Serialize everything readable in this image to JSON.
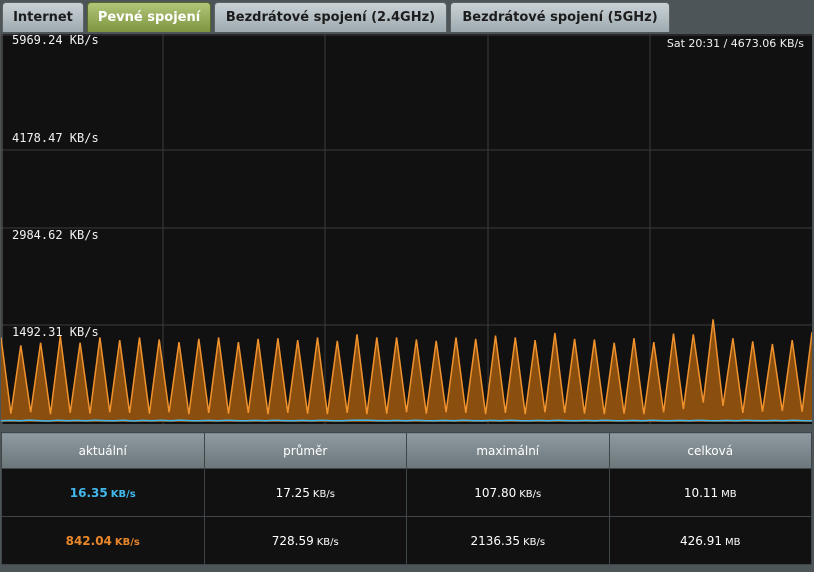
{
  "tabs": [
    {
      "label": "Internet",
      "active": false
    },
    {
      "label": "Pevné spojení",
      "active": true
    },
    {
      "label": "Bezdrátové spojení (2.4GHz)",
      "active": false
    },
    {
      "label": "Bezdrátové spojení (5GHz)",
      "active": false
    }
  ],
  "graph": {
    "y_ticks": [
      "5969.24 KB/s",
      "4178.47 KB/s",
      "2984.62 KB/s",
      "1492.31 KB/s"
    ],
    "cursor_readout": "Sat 20:31 / 4673.06 KB/s",
    "colors": {
      "background": "#111111",
      "grid": "#3a3a3a",
      "tx_fill": "#8a4f0e",
      "tx_line": "#f0922e",
      "rx_line": "#43b8ec"
    }
  },
  "chart_data": {
    "type": "area",
    "y_unit": "KB/s",
    "y_tick_values": [
      5969.24,
      4178.47,
      2984.62,
      1492.31
    ],
    "series": [
      {
        "role": "tx",
        "color": "#f0922e",
        "values": [
          1300,
          130,
          1180,
          150,
          1220,
          120,
          1320,
          140,
          1220,
          130,
          1300,
          150,
          1260,
          140,
          1300,
          130,
          1270,
          150,
          1230,
          120,
          1280,
          140,
          1300,
          130,
          1230,
          140,
          1280,
          120,
          1290,
          140,
          1260,
          130,
          1300,
          120,
          1250,
          140,
          1350,
          120,
          1300,
          130,
          1300,
          150,
          1270,
          130,
          1250,
          150,
          1300,
          140,
          1280,
          120,
          1330,
          140,
          1300,
          120,
          1260,
          150,
          1370,
          140,
          1280,
          130,
          1270,
          120,
          1220,
          130,
          1290,
          120,
          1230,
          150,
          1360,
          200,
          1350,
          300,
          1580,
          250,
          1290,
          140,
          1240,
          160,
          1200,
          170,
          1260,
          160,
          1380
        ]
      },
      {
        "role": "rx",
        "color": "#43b8ec",
        "values": [
          20,
          25,
          18,
          30,
          22,
          15,
          28,
          20,
          24,
          18,
          26,
          22,
          20,
          28,
          16,
          24,
          20,
          26,
          18,
          30,
          22,
          20,
          25,
          18,
          28,
          22,
          20,
          24,
          18,
          26,
          22,
          20,
          25,
          18,
          28,
          22,
          20,
          24,
          30,
          26,
          22,
          20,
          25,
          18,
          28,
          22,
          20,
          24,
          18,
          26,
          22,
          20,
          25,
          18,
          28,
          22,
          20,
          24,
          18,
          26,
          22,
          20,
          25,
          18,
          28,
          22,
          20,
          24,
          18,
          26,
          22,
          20,
          25,
          18,
          28,
          22,
          20,
          24,
          18,
          26,
          22,
          20,
          25,
          18,
          28,
          22,
          20
        ]
      }
    ]
  },
  "stats": {
    "headers": [
      "aktuální",
      "průměr",
      "maximální",
      "celková"
    ],
    "rows": [
      {
        "class": "rx",
        "cells": [
          {
            "value": "16.35",
            "unit": "KB/s"
          },
          {
            "value": "17.25",
            "unit": "KB/s"
          },
          {
            "value": "107.80",
            "unit": "KB/s"
          },
          {
            "value": "10.11",
            "unit": "MB"
          }
        ]
      },
      {
        "class": "tx",
        "cells": [
          {
            "value": "842.04",
            "unit": "KB/s"
          },
          {
            "value": "728.59",
            "unit": "KB/s"
          },
          {
            "value": "2136.35",
            "unit": "KB/s"
          },
          {
            "value": "426.91",
            "unit": "MB"
          }
        ]
      }
    ]
  }
}
